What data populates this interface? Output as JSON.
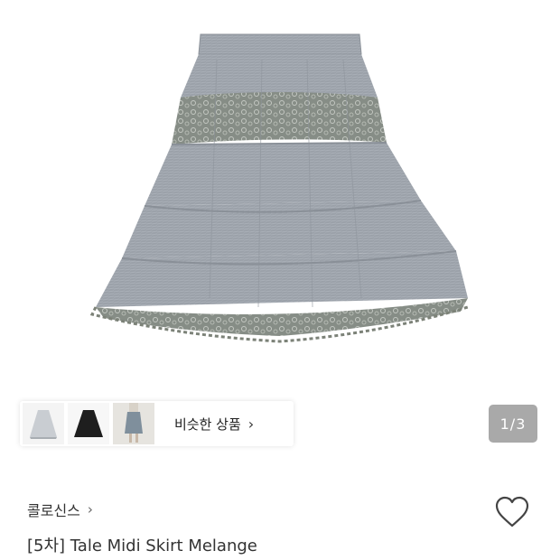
{
  "gallery": {
    "page_current": "1",
    "page_separator": "/",
    "page_total": "3"
  },
  "similar": {
    "label": "비슷한 상품",
    "chevron": "›",
    "thumbnails": [
      "thumbnail-grey-skirt",
      "thumbnail-black-skirt",
      "thumbnail-model-skirt"
    ]
  },
  "product": {
    "brand": "콜로신스",
    "brand_chevron": "›",
    "title": "[5차] Tale Midi Skirt Melange"
  },
  "icons": {
    "like": "heart-outline-icon"
  },
  "colors": {
    "skirt": "#9aa0a8",
    "lace": "#7c8278",
    "indicator_bg": "#a9a9a9"
  }
}
